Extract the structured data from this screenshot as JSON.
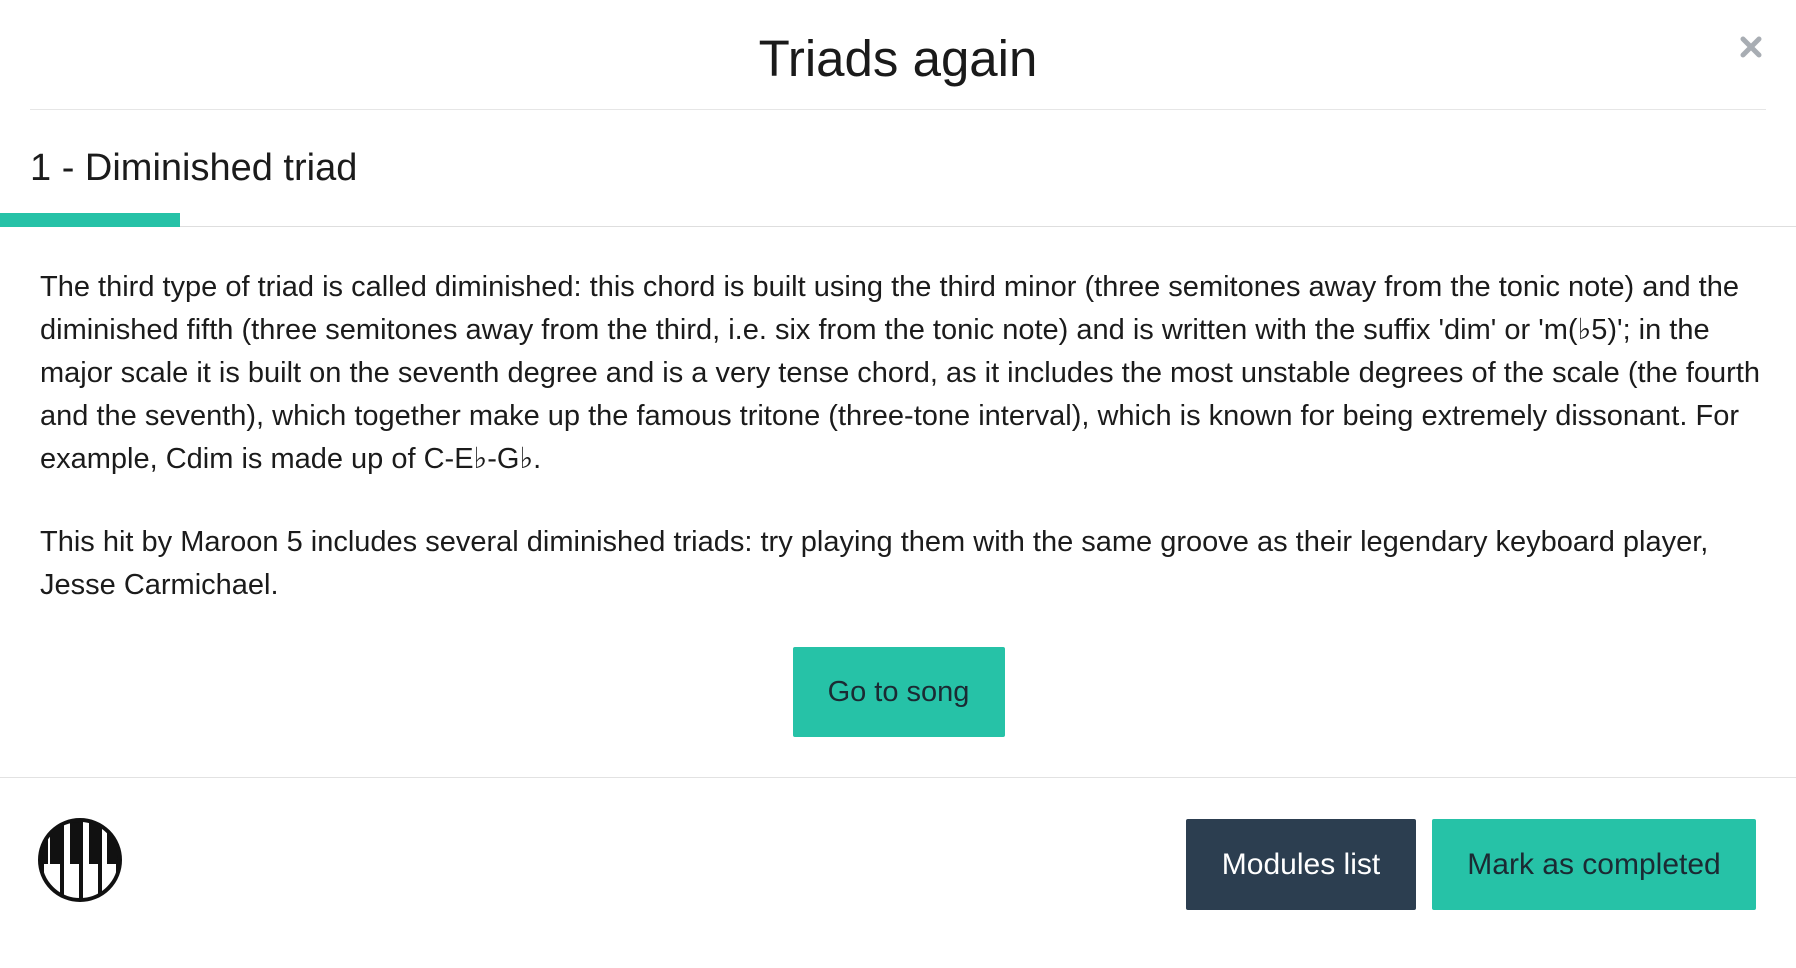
{
  "modal": {
    "title": "Triads again",
    "close_icon": "close-icon"
  },
  "lesson": {
    "title": "1 - Diminished triad",
    "progress_fraction": 0.1
  },
  "content": {
    "paragraphs": [
      "The third type of triad is called diminished: this chord is built using the third minor (three semitones away from the tonic note) and the diminished fifth (three semitones away from the third, i.e. six from the tonic note) and is written with the suffix 'dim' or 'm(♭5)'; in the major scale it is built on the seventh degree and is a very tense chord, as it includes the most unstable degrees of the scale (the fourth and the seventh), which together make up the famous tritone (three-tone interval), which is known for being extremely dissonant. For example, Cdim is made up of C-E♭-G♭.",
      "This hit by Maroon 5 includes several diminished triads: try playing them with the same groove as their legendary keyboard player, Jesse Carmichael."
    ],
    "go_to_song_label": "Go to song"
  },
  "footer": {
    "logo_icon": "piano-keys-icon",
    "modules_list_label": "Modules list",
    "mark_completed_label": "Mark as completed"
  },
  "colors": {
    "accent": "#26c2a7",
    "dark_button": "#2c3e50"
  }
}
